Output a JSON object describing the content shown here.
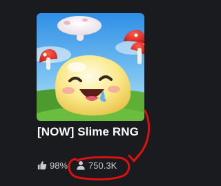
{
  "game": {
    "title": "[NOW] Slime RNG",
    "rating": "98%",
    "players": "750.3K"
  },
  "icons": {
    "rating": "thumbs-up-icon",
    "players": "person-icon"
  },
  "colors": {
    "background": "#1a1b1e",
    "title": "#ffffff",
    "stats": "#c8cacc",
    "annotation": "#e01010"
  }
}
